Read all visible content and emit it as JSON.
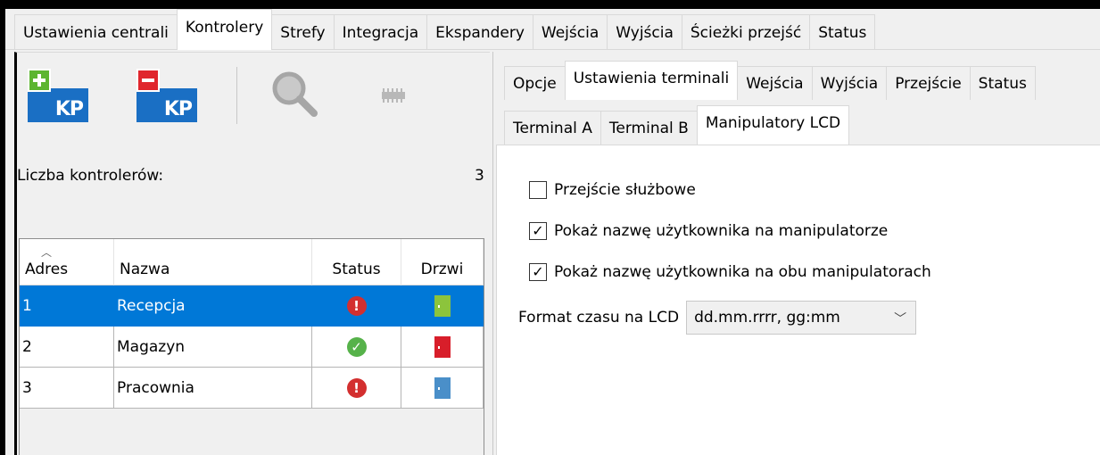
{
  "top_tabs": [
    "Ustawienia centrali",
    "Kontrolery",
    "Strefy",
    "Integracja",
    "Ekspandery",
    "Wejścia",
    "Wyjścia",
    "Ścieżki przejść",
    "Status"
  ],
  "toolbar": {
    "add_label": "KP",
    "remove_label": "KP",
    "icons": [
      "add-keypad-icon",
      "remove-keypad-icon",
      "search-icon",
      "module-icon"
    ]
  },
  "controllers": {
    "count_label": "Liczba kontrolerów:",
    "count_value": "3",
    "headers": [
      "Adres",
      "Nazwa",
      "Status",
      "Drzwi"
    ],
    "rows": [
      {
        "adres": "1",
        "nazwa": "Recepcja",
        "status": "error",
        "door_color": "#8cc43c",
        "selected": true
      },
      {
        "adres": "2",
        "nazwa": "Magazyn",
        "status": "ok",
        "door_color": "#d81e2a",
        "selected": false
      },
      {
        "adres": "3",
        "nazwa": "Pracownia",
        "status": "error",
        "door_color": "#4a8fc9",
        "selected": false
      }
    ]
  },
  "sub_tabs": [
    "Opcje",
    "Ustawienia terminali",
    "Wejścia",
    "Wyjścia",
    "Przejście",
    "Status"
  ],
  "terminal_tabs": [
    "Terminal A",
    "Terminal B",
    "Manipulatory LCD"
  ],
  "options": {
    "service_passage": {
      "label": "Przejście służbowe",
      "checked": false
    },
    "show_user_name": {
      "label": "Pokaż nazwę użytkownika na manipulatorze",
      "checked": true
    },
    "show_user_name_both": {
      "label": "Pokaż nazwę użytkownika na obu manipulatorach",
      "checked": true
    }
  },
  "time_format": {
    "label": "Format czasu na LCD",
    "value": "dd.mm.rrrr, gg:mm"
  },
  "colors": {
    "selection": "#0078d7",
    "error": "#d32f2f",
    "ok": "#56b24a"
  }
}
